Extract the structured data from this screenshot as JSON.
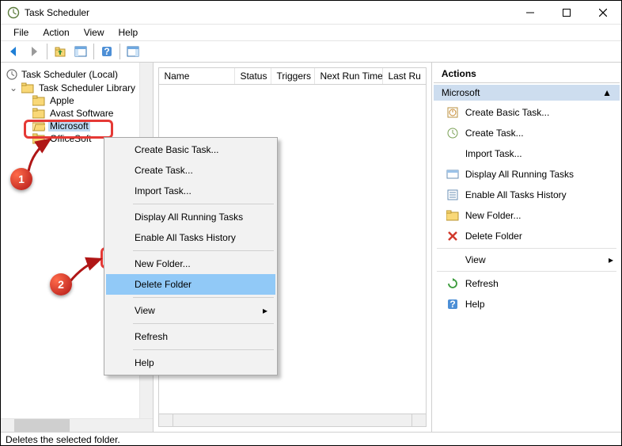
{
  "window": {
    "title": "Task Scheduler"
  },
  "menus": {
    "file": "File",
    "action": "Action",
    "view": "View",
    "help": "Help"
  },
  "tree": {
    "root": "Task Scheduler (Local)",
    "library": "Task Scheduler Library",
    "items": [
      "Apple",
      "Avast Software",
      "Microsoft",
      "OfficeSoft"
    ]
  },
  "columns": {
    "name": "Name",
    "status": "Status",
    "triggers": "Triggers",
    "nextrun": "Next Run Time",
    "lastrun": "Last Ru"
  },
  "actions": {
    "header": "Actions",
    "group": "Microsoft",
    "items": {
      "create_basic": "Create Basic Task...",
      "create_task": "Create Task...",
      "import": "Import Task...",
      "display_running": "Display All Running Tasks",
      "enable_history": "Enable All Tasks History",
      "new_folder": "New Folder...",
      "delete_folder": "Delete Folder",
      "view": "View",
      "refresh": "Refresh",
      "help": "Help"
    }
  },
  "context_menu": {
    "create_basic": "Create Basic Task...",
    "create_task": "Create Task...",
    "import": "Import Task...",
    "display_running": "Display All Running Tasks",
    "enable_history": "Enable All Tasks History",
    "new_folder": "New Folder...",
    "delete_folder": "Delete Folder",
    "view": "View",
    "refresh": "Refresh",
    "help": "Help"
  },
  "status": "Deletes the selected folder.",
  "callouts": {
    "one": "1",
    "two": "2"
  }
}
